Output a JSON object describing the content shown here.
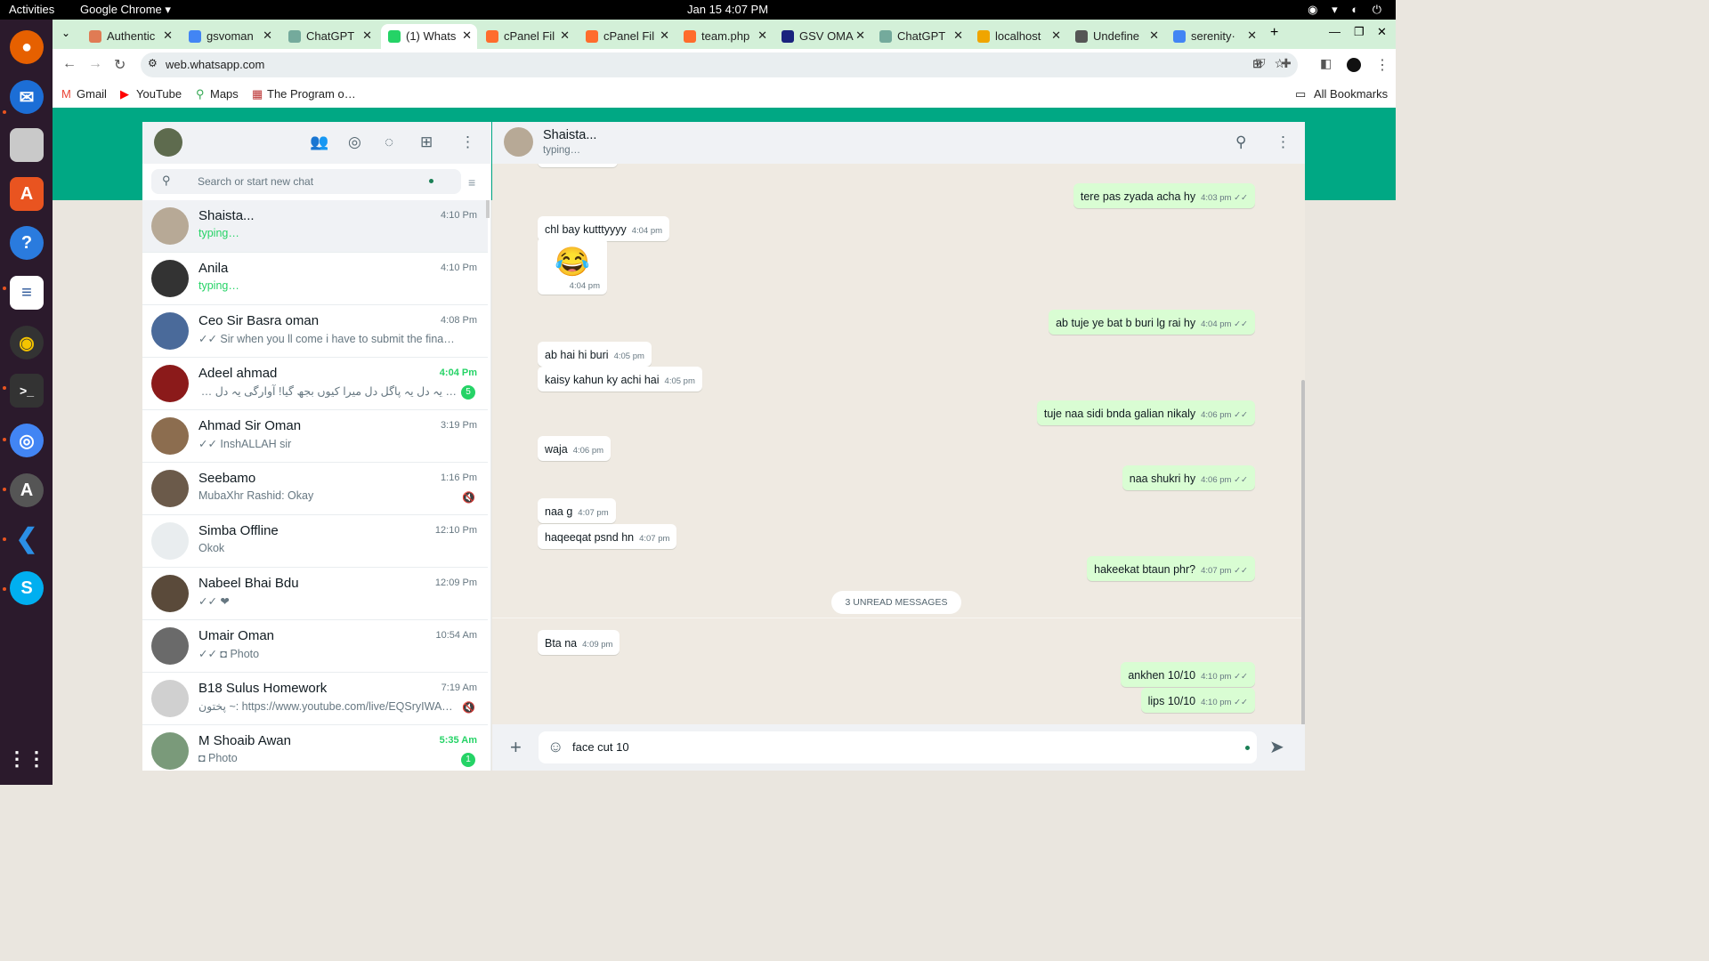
{
  "topbar": {
    "activities": "Activities",
    "app": "Google Chrome ▾",
    "clock": "Jan 15  4:07 PM",
    "tray": "◉ ▾ ◐ ⏻"
  },
  "tabs": [
    {
      "label": "Authentic",
      "color": "#e07b54"
    },
    {
      "label": "gsvoman",
      "color": "#4285f4"
    },
    {
      "label": "ChatGPT",
      "color": "#74aa9c"
    },
    {
      "label": "(1) Whats",
      "color": "#25d366"
    },
    {
      "label": "cPanel Fil",
      "color": "#ff6c2c"
    },
    {
      "label": "cPanel Fil",
      "color": "#ff6c2c"
    },
    {
      "label": "team.php",
      "color": "#ff6c2c"
    },
    {
      "label": "GSV OMA",
      "color": "#1a237e"
    },
    {
      "label": "ChatGPT",
      "color": "#74aa9c"
    },
    {
      "label": "localhost",
      "color": "#f0a500"
    },
    {
      "label": "Undefine",
      "color": "#555555"
    },
    {
      "label": "serenity·",
      "color": "#4285f4"
    }
  ],
  "url": "web.whatsapp.com",
  "bookmarks": {
    "gmail": "Gmail",
    "youtube": "YouTube",
    "maps": "Maps",
    "program": "The Program o…",
    "all": "All Bookmarks"
  },
  "search": {
    "placeholder": "Search or start new chat"
  },
  "chats": [
    {
      "name": "Shaista...",
      "time": "4:10 Pm",
      "preview": "typing…",
      "typing": true
    },
    {
      "name": "Anila",
      "time": "4:10 Pm",
      "preview": "typing…",
      "typing": true
    },
    {
      "name": "Ceo Sir Basra oman",
      "time": "4:08 Pm",
      "preview": "✓✓ Sir when you ll come i have to submit the final report sir"
    },
    {
      "name": "Adeel ahmad",
      "time": "4:04 Pm",
      "preview": "…  یہ دل یہ پاگل دل میرا کیوں بجھ گیا! آوارگی  یہ دل یہ پاگل",
      "badge": "5"
    },
    {
      "name": "Ahmad Sir  Oman",
      "time": "3:19 Pm",
      "preview": "✓✓ InshALLAH sir"
    },
    {
      "name": "Seebamo",
      "time": "1:16 Pm",
      "preview": "MubaXhr Rashid: Okay"
    },
    {
      "name": "Simba Offline",
      "time": "12:10 Pm",
      "preview": "Okok"
    },
    {
      "name": "Nabeel Bhai Bdu",
      "time": "12:09 Pm",
      "preview": "✓✓ ❤"
    },
    {
      "name": "Umair Oman",
      "time": "10:54 Am",
      "preview": "✓✓ ◘ Photo"
    },
    {
      "name": "B18 Sulus Homework",
      "time": "7:19 Am",
      "preview": "پختون ~: https://www.youtube.com/live/EQSryIWAwow?…"
    },
    {
      "name": "M Shoaib Awan",
      "time": "5:35 Am",
      "preview": "◘ Photo",
      "badge": "1"
    }
  ],
  "contact": {
    "name": "Shaista...",
    "status": "typing…"
  },
  "messages": [
    {
      "text": "tere pas zyada acha hy",
      "time": "4:03 pm ✓✓"
    },
    {
      "text": "chl bay kutttyyyy",
      "time": "4:04 pm"
    },
    {
      "text": "😂",
      "time": "4:04 pm"
    },
    {
      "text": "ab tuje ye bat b buri lg rai hy",
      "time": "4:04 pm ✓✓"
    },
    {
      "text": "ab hai hi buri",
      "time": "4:05 pm"
    },
    {
      "text": "kaisy kahun ky achi hai",
      "time": "4:05 pm"
    },
    {
      "text": "tuje naa sidi bnda galian nikaly",
      "time": "4:06 pm ✓✓"
    },
    {
      "text": "waja",
      "time": "4:06 pm"
    },
    {
      "text": "naa shukri hy",
      "time": "4:06 pm ✓✓"
    },
    {
      "text": "naa g",
      "time": "4:07 pm"
    },
    {
      "text": "haqeeqat psnd hn",
      "time": "4:07 pm"
    },
    {
      "text": "hakeekat btaun phr?",
      "time": "4:07 pm ✓✓"
    },
    {
      "text": "Bta na",
      "time": "4:09 pm"
    },
    {
      "text": "ankhen 10/10",
      "time": "4:10 pm ✓✓"
    },
    {
      "text": "lips 10/10",
      "time": "4:10 pm ✓✓"
    }
  ],
  "unread_label": "3 UNREAD MESSAGES",
  "composer": {
    "value": "face cut 10"
  },
  "colors": {
    "accent": "#00a884",
    "outgoing": "#d9fdd3",
    "typing": "#25d366"
  }
}
